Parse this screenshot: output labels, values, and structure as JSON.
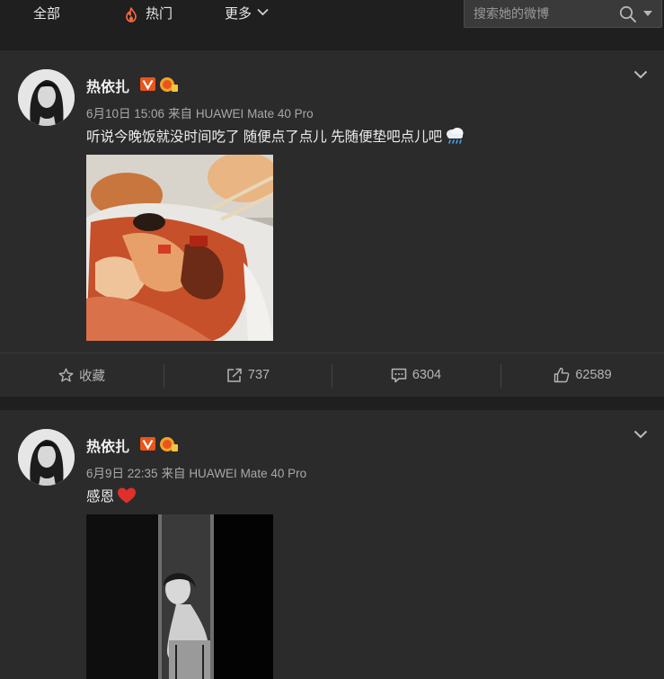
{
  "nav": {
    "all_label": "全部",
    "hot_label": "热门",
    "more_label": "更多",
    "search_placeholder": "搜索她的微博"
  },
  "posts": [
    {
      "username": "热依扎",
      "timestamp": "6月10日 15:06",
      "source": "来自 HUAWEI Mate 40 Pro",
      "text": "听说今晚饭就没时间吃了 随便点了点儿 先随便垫吧点儿吧",
      "actions": {
        "favorite_label": "收藏",
        "repost_count": "737",
        "comment_count": "6304",
        "like_count": "62589"
      }
    },
    {
      "username": "热依扎",
      "timestamp": "6月9日 22:35",
      "source": "来自 HUAWEI Mate 40 Pro",
      "text": "感恩"
    }
  ],
  "colors": {
    "background": "#1f1f1f",
    "card": "#2b2b2b",
    "verified_badge": "#e8551c",
    "hot_flame": "#ff6a3d",
    "heart": "#e0302c"
  }
}
